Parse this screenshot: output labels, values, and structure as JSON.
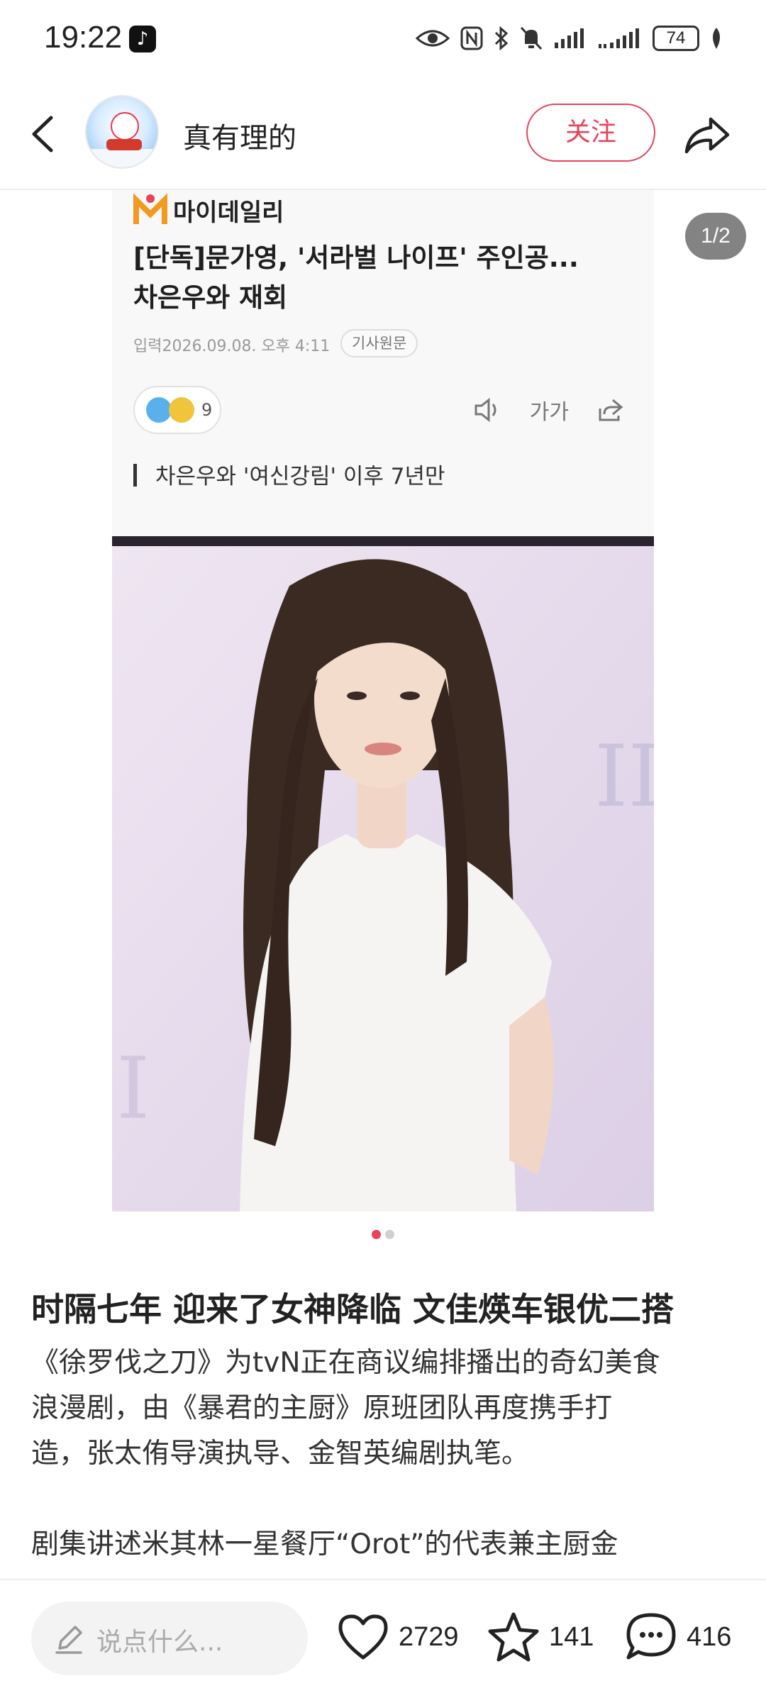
{
  "status_bar": {
    "time": "19:22",
    "battery": "74",
    "icons": [
      "tiktok-icon",
      "eye-icon",
      "nfc-icon",
      "bluetooth-icon",
      "mute-icon",
      "signal-icon",
      "signal-icon",
      "leaf-icon"
    ]
  },
  "header": {
    "username": "真有理的",
    "follow_label": "关注"
  },
  "media": {
    "page_counter": "1/2",
    "card": {
      "source_logo": "마이데일리",
      "title_line1": "[단독]문가영, '서라벌 나이프' 주인공...",
      "title_line2": "차은우와 재회",
      "date": "입력2026.09.08. 오후 4:11",
      "original_badge": "기사원문",
      "reaction_count": "9",
      "font_size_label": "가가",
      "subheadline": "차은우와 '여신강림' 이후 7년만"
    },
    "dots_total": 2,
    "dots_active": 1
  },
  "post": {
    "title": "时隔七年 迎来了女神降临 文佳煐车银优二搭",
    "para1_line1": "《徐罗伐之刀》为tvN正在商议编排播出的奇幻美食",
    "para1_line2": "浪漫剧，由《暴君的主厨》原班团队再度携手打",
    "para1_line3": "造，张太侑导演执导、金智英编剧执笔。",
    "para2_line1": "剧集讲述米其林一星餐厅“Orot”的代表兼主厨金"
  },
  "bottom_bar": {
    "comment_placeholder": "说点什么...",
    "likes": "2729",
    "favorites": "141",
    "comments": "416"
  },
  "colors": {
    "accent": "#e8435a",
    "text": "#222222",
    "muted": "#999999"
  }
}
